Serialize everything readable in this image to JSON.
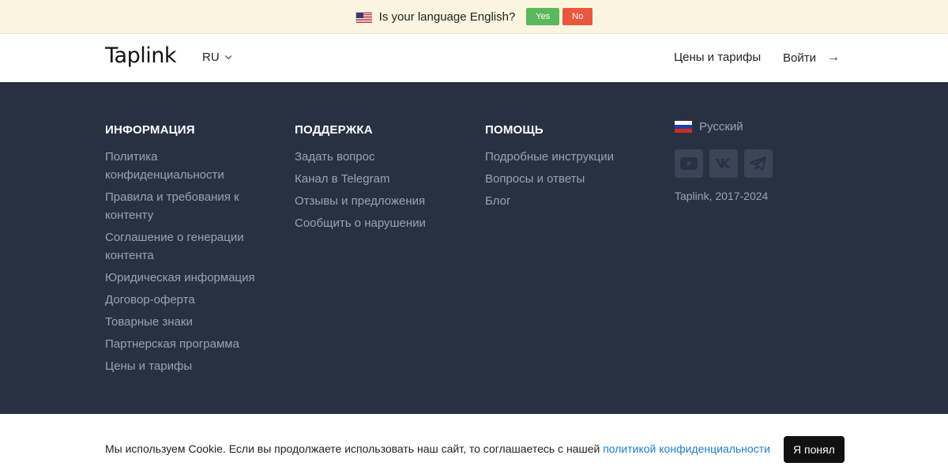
{
  "language_banner": {
    "question": "Is your language English?",
    "yes_label": "Yes",
    "no_label": "No",
    "yes_color": "#5cb85c",
    "no_color": "#e8583f"
  },
  "header": {
    "logo": "Taplink",
    "language": "RU",
    "nav_prices": "Цены и тарифы",
    "nav_login": "Войти"
  },
  "footer": {
    "columns": [
      {
        "title": "ИНФОРМАЦИЯ",
        "links": [
          "Политика конфиденциальности",
          "Правила и требования к контенту",
          "Соглашение о генерации контента",
          "Юридическая информация",
          "Договор-оферта",
          "Товарные знаки",
          "Партнерская программа",
          "Цены и тарифы"
        ]
      },
      {
        "title": "ПОДДЕРЖКА",
        "links": [
          "Задать вопрос",
          "Канал в Telegram",
          "Отзывы и предложения",
          "Сообщить о нарушении"
        ]
      },
      {
        "title": "ПОМОЩЬ",
        "links": [
          "Подробные инструкции",
          "Вопросы и ответы",
          "Блог"
        ]
      }
    ],
    "language_label": "Русский",
    "socials": [
      "youtube-icon",
      "vk-icon",
      "telegram-icon"
    ],
    "copyright": "Taplink, 2017-2024",
    "background_color": "#273142"
  },
  "cookie_banner": {
    "text": "Мы используем Cookie. Если вы продолжаете использовать наш сайт, то соглашаетесь с нашей",
    "link_text": "политикой конфиденциальности",
    "button_label": "Я понял"
  }
}
